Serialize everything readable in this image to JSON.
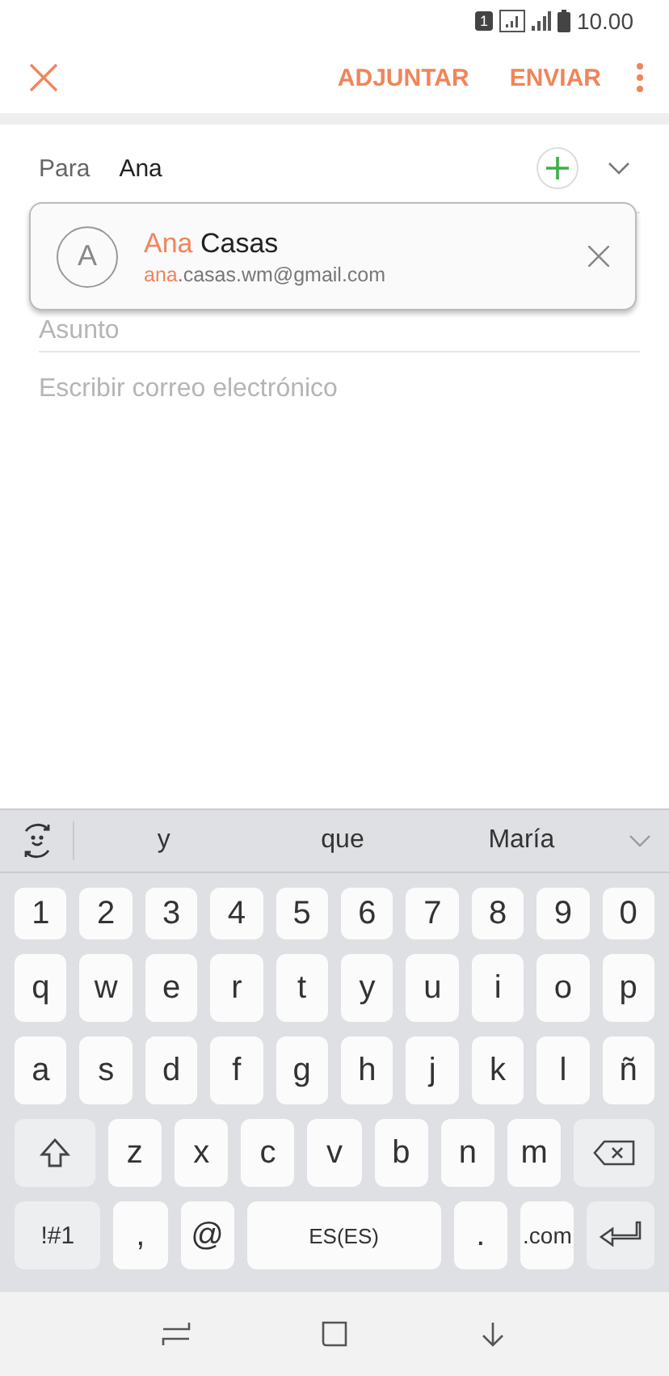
{
  "status_bar": {
    "sim": "1",
    "time": "10.00"
  },
  "toolbar": {
    "actions": [
      "ADJUNTAR",
      "ENVIAR"
    ]
  },
  "to_field": {
    "label": "Para",
    "value": "Ana"
  },
  "suggestion": {
    "initial": "A",
    "name_match": "Ana",
    "name_rest": " Casas",
    "email_match": "ana",
    "email_rest": ".casas.wm@gmail.com"
  },
  "subject": {
    "placeholder": "Asunto"
  },
  "body": {
    "placeholder": "Escribir correo electrónico"
  },
  "predictions": [
    "y",
    "que",
    "María"
  ],
  "keyboard": [
    [
      {
        "kind": "char",
        "label": "1"
      },
      {
        "kind": "char",
        "label": "2"
      },
      {
        "kind": "char",
        "label": "3"
      },
      {
        "kind": "char",
        "label": "4"
      },
      {
        "kind": "char",
        "label": "5"
      },
      {
        "kind": "char",
        "label": "6"
      },
      {
        "kind": "char",
        "label": "7"
      },
      {
        "kind": "char",
        "label": "8"
      },
      {
        "kind": "char",
        "label": "9"
      },
      {
        "kind": "char",
        "label": "0"
      }
    ],
    [
      {
        "kind": "char",
        "label": "q"
      },
      {
        "kind": "char",
        "label": "w"
      },
      {
        "kind": "char",
        "label": "e"
      },
      {
        "kind": "char",
        "label": "r"
      },
      {
        "kind": "char",
        "label": "t"
      },
      {
        "kind": "char",
        "label": "y"
      },
      {
        "kind": "char",
        "label": "u"
      },
      {
        "kind": "char",
        "label": "i"
      },
      {
        "kind": "char",
        "label": "o"
      },
      {
        "kind": "char",
        "label": "p"
      }
    ],
    [
      {
        "kind": "char",
        "label": "a"
      },
      {
        "kind": "char",
        "label": "s"
      },
      {
        "kind": "char",
        "label": "d"
      },
      {
        "kind": "char",
        "label": "f"
      },
      {
        "kind": "char",
        "label": "g"
      },
      {
        "kind": "char",
        "label": "h"
      },
      {
        "kind": "char",
        "label": "j"
      },
      {
        "kind": "char",
        "label": "k"
      },
      {
        "kind": "char",
        "label": "l"
      },
      {
        "kind": "char",
        "label": "ñ"
      }
    ],
    [
      {
        "kind": "shift"
      },
      {
        "kind": "char",
        "label": "z"
      },
      {
        "kind": "char",
        "label": "x"
      },
      {
        "kind": "char",
        "label": "c"
      },
      {
        "kind": "char",
        "label": "v"
      },
      {
        "kind": "char",
        "label": "b"
      },
      {
        "kind": "char",
        "label": "n"
      },
      {
        "kind": "char",
        "label": "m"
      },
      {
        "kind": "backspace"
      }
    ],
    [
      {
        "kind": "symbols",
        "label": "!#1"
      },
      {
        "kind": "char",
        "label": ","
      },
      {
        "kind": "char",
        "label": "@"
      },
      {
        "kind": "space",
        "label": "ES(ES)"
      },
      {
        "kind": "char",
        "label": "."
      },
      {
        "kind": "char",
        "label": ".com"
      },
      {
        "kind": "enter"
      }
    ]
  ]
}
